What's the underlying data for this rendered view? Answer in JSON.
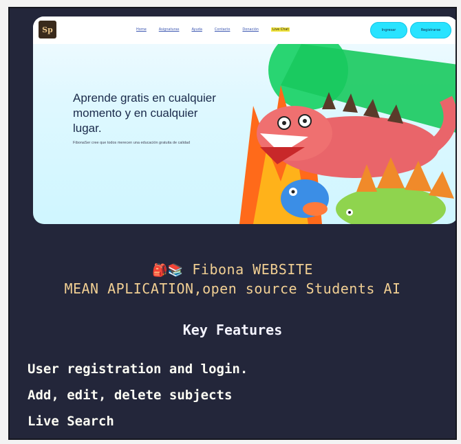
{
  "site": {
    "logo_text": "Sp",
    "nav": [
      "Home",
      "Asignaturas",
      "Ayuda",
      "Contacto",
      "Donación",
      "Live Chat"
    ],
    "buttons": {
      "login": "Ingresar",
      "register": "Registrarse"
    },
    "hero": {
      "headline": "Aprende gratis en cualquier momento y en cualquier lugar.",
      "subtext": "FibonaSer cree que todos merecen una educación gratuita de calidad"
    }
  },
  "caption": {
    "icons": "🎒📚",
    "title": "Fibona WEBSITE",
    "subtitle": "MEAN APLICATION,open source Students AI",
    "section": "Key Features"
  },
  "features": [
    "User registration and login.",
    "Add, edit, delete subjects",
    "Live Search"
  ],
  "colors": {
    "background": "#23263a",
    "caption_gold": "#f1cf93",
    "button_cyan": "#29e3ff"
  }
}
